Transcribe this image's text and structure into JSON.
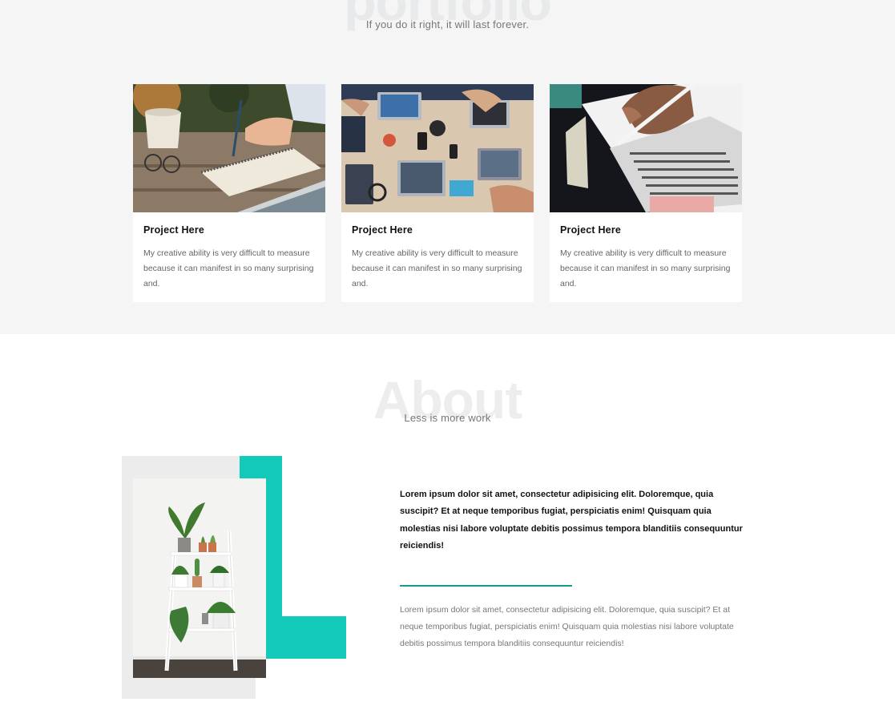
{
  "portfolio": {
    "heading": "portfolio",
    "subtitle": "If you do it right, it will last forever.",
    "cards": [
      {
        "image": "notebook-writing-photo",
        "title": "Project Here",
        "text": "My creative ability is very difficult to measure because it can manifest in so many surprising and."
      },
      {
        "image": "team-laptops-desk-photo",
        "title": "Project Here",
        "text": "My creative ability is very difficult to measure because it can manifest in so many surprising and."
      },
      {
        "image": "answer-sheet-pencil-photo",
        "title": "Project Here",
        "text": "My creative ability is very difficult to measure because it can manifest in so many surprising and."
      }
    ]
  },
  "about": {
    "heading": "About",
    "subtitle": "Less is more work",
    "image": "plant-ladder-shelf-photo",
    "lead": "Lorem ipsum dolor sit amet, consectetur adipisicing elit. Doloremque, quia suscipit? Et at neque temporibus fugiat, perspiciatis enim! Quisquam quia molestias nisi labore voluptate debitis possimus tempora blanditiis consequuntur reiciendis!",
    "body": "Lorem ipsum dolor sit amet, consectetur adipisicing elit. Doloremque, quia suscipit? Et at neque temporibus fugiat, perspiciatis enim! Quisquam quia molestias nisi labore voluptate debitis possimus tempora blanditiis consequuntur reiciendis!"
  },
  "colors": {
    "accent": "#13c9b7",
    "divider": "#169c8f",
    "section_bg": "#f5f5f5",
    "watermark": "#e9eaec"
  }
}
